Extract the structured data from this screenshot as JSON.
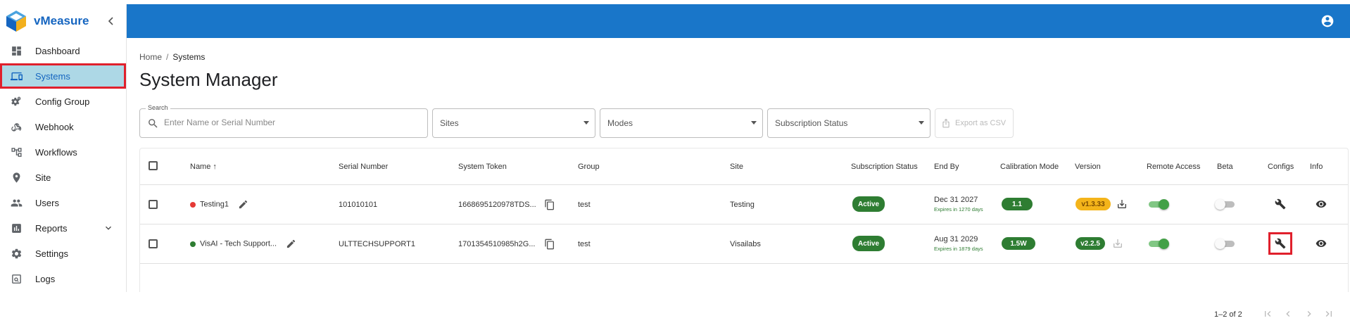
{
  "app": {
    "name": "vMeasure"
  },
  "sidebar": {
    "items": [
      {
        "label": "Dashboard",
        "icon": "dashboard-icon"
      },
      {
        "label": "Systems",
        "icon": "devices-icon",
        "active": true
      },
      {
        "label": "Config Group",
        "icon": "gears-icon"
      },
      {
        "label": "Webhook",
        "icon": "webhook-icon"
      },
      {
        "label": "Workflows",
        "icon": "workflow-icon"
      },
      {
        "label": "Site",
        "icon": "location-pin-icon"
      },
      {
        "label": "Users",
        "icon": "users-icon"
      },
      {
        "label": "Reports",
        "icon": "bar-chart-icon",
        "expandable": true
      },
      {
        "label": "Settings",
        "icon": "gear-icon"
      },
      {
        "label": "Logs",
        "icon": "search-doc-icon"
      }
    ]
  },
  "breadcrumb": {
    "home": "Home",
    "sep": "/",
    "current": "Systems"
  },
  "page": {
    "title": "System Manager"
  },
  "filters": {
    "search_label": "Search",
    "search_placeholder": "Enter Name or Serial Number",
    "sites": "Sites",
    "modes": "Modes",
    "subscription_status": "Subscription Status",
    "export": "Export as CSV"
  },
  "table": {
    "headers": {
      "name": "Name",
      "serial": "Serial Number",
      "token": "System Token",
      "group": "Group",
      "site": "Site",
      "subscription": "Subscription Status",
      "end_by": "End By",
      "calibration": "Calibration Mode",
      "version": "Version",
      "remote": "Remote Access",
      "beta": "Beta",
      "configs": "Configs",
      "info": "Info"
    },
    "rows": [
      {
        "name": "Testing1",
        "status_color": "#e53935",
        "serial": "101010101",
        "token": "1668695120978TDS...",
        "group": "test",
        "site": "Testing",
        "subscription": "Active",
        "end_by": "Dec 31 2027",
        "expires": "Expires in 1270 days",
        "calibration": "1.1",
        "version": "v1.3.33",
        "remote_access": true,
        "beta": false
      },
      {
        "name": "VisAI - Tech Support...",
        "status_color": "#2e7d32",
        "serial": "ULTTECHSUPPORT1",
        "token": "1701354510985h2G...",
        "group": "test",
        "site": "Visailabs",
        "subscription": "Active",
        "end_by": "Aug 31 2029",
        "expires": "Expires in 1879 days",
        "calibration": "1.5W",
        "version": "v2.2.5",
        "remote_access": true,
        "beta": false
      }
    ]
  },
  "pagination": {
    "range": "1–2 of 2"
  },
  "colors": {
    "topbar": "#1976c9",
    "active_nav_bg": "#add8e6",
    "highlight": "#e0202c",
    "chip_green": "#2e7d32",
    "chip_amber": "#f4b41a"
  }
}
